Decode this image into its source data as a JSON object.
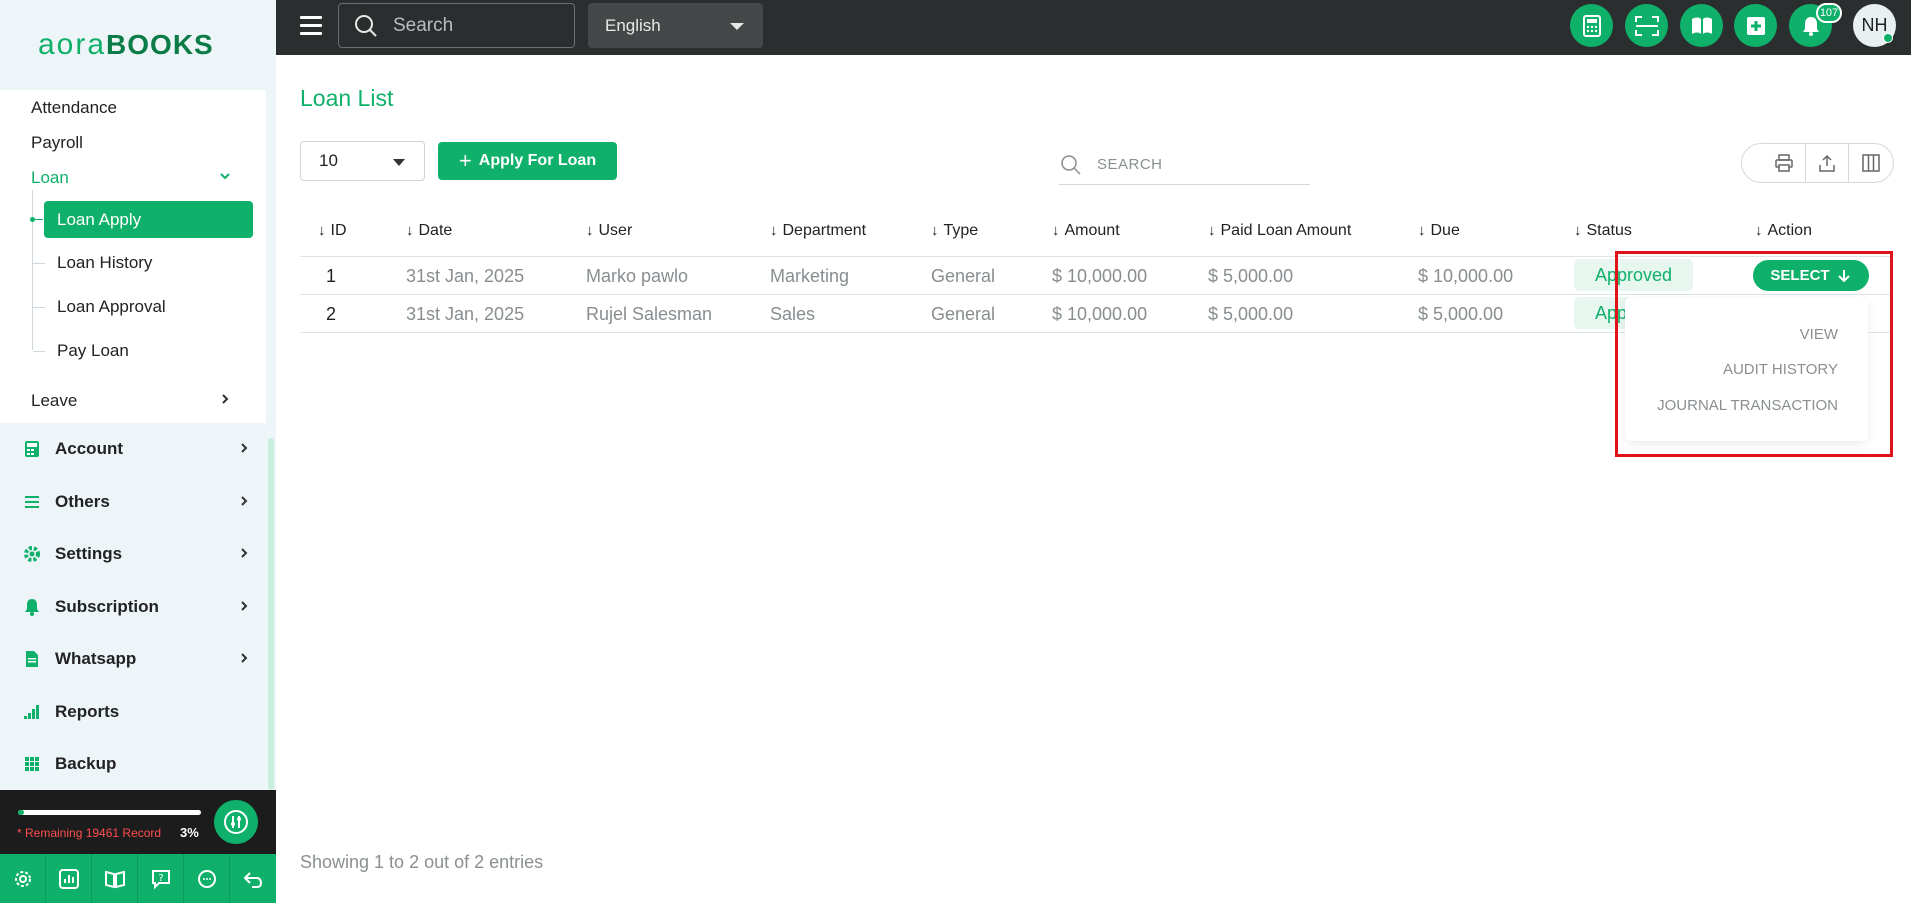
{
  "app": {
    "logo_part1": "aora",
    "logo_part2": "BOOKS"
  },
  "topbar": {
    "search_placeholder": "Search",
    "language": "English",
    "notification_count": "107",
    "avatar_initials": "NH"
  },
  "sidebar": {
    "sub_items": [
      {
        "label": "Attendance"
      },
      {
        "label": "Payroll"
      },
      {
        "label": "Loan"
      }
    ],
    "loan_children": [
      {
        "label": "Loan Apply"
      },
      {
        "label": "Loan History"
      },
      {
        "label": "Loan Approval"
      },
      {
        "label": "Pay Loan"
      }
    ],
    "leave_label": "Leave",
    "main_items": [
      {
        "label": "Account",
        "icon": "calculator-icon"
      },
      {
        "label": "Others",
        "icon": "list-icon"
      },
      {
        "label": "Settings",
        "icon": "gear-icon"
      },
      {
        "label": "Subscription",
        "icon": "bell-icon"
      },
      {
        "label": "Whatsapp",
        "icon": "document-icon"
      },
      {
        "label": "Reports",
        "icon": "bar-signal-icon"
      },
      {
        "label": "Backup",
        "icon": "grid-icon"
      }
    ],
    "record_text": "* Remaining 19461 Record",
    "record_percent": "3%",
    "record_progress": 0.03
  },
  "main": {
    "title": "Loan List",
    "per_page": "10",
    "apply_button": "Apply For Loan",
    "search_placeholder": "SEARCH",
    "columns": [
      "ID",
      "Date",
      "User",
      "Department",
      "Type",
      "Amount",
      "Paid Loan Amount",
      "Due",
      "Status",
      "Action"
    ],
    "rows": [
      {
        "id": "1",
        "date": "31st Jan, 2025",
        "user": "Marko pawlo",
        "department": "Marketing",
        "type": "General",
        "amount": "$ 10,000.00",
        "paid": "$ 5,000.00",
        "due": "$ 10,000.00",
        "status": "Approved"
      },
      {
        "id": "2",
        "date": "31st Jan, 2025",
        "user": "Rujel Salesman",
        "department": "Sales",
        "type": "General",
        "amount": "$ 10,000.00",
        "paid": "$ 5,000.00",
        "due": "$ 5,000.00",
        "status": "Approved"
      }
    ],
    "select_button": "SELECT",
    "dropdown": [
      "VIEW",
      "AUDIT HISTORY",
      "JOURNAL TRANSACTION"
    ],
    "footer": "Showing 1 to 2 out of 2 entries"
  },
  "colors": {
    "brand": "#0fb16a",
    "topbar": "#2b2e2f",
    "highlight": "#e0131b"
  }
}
